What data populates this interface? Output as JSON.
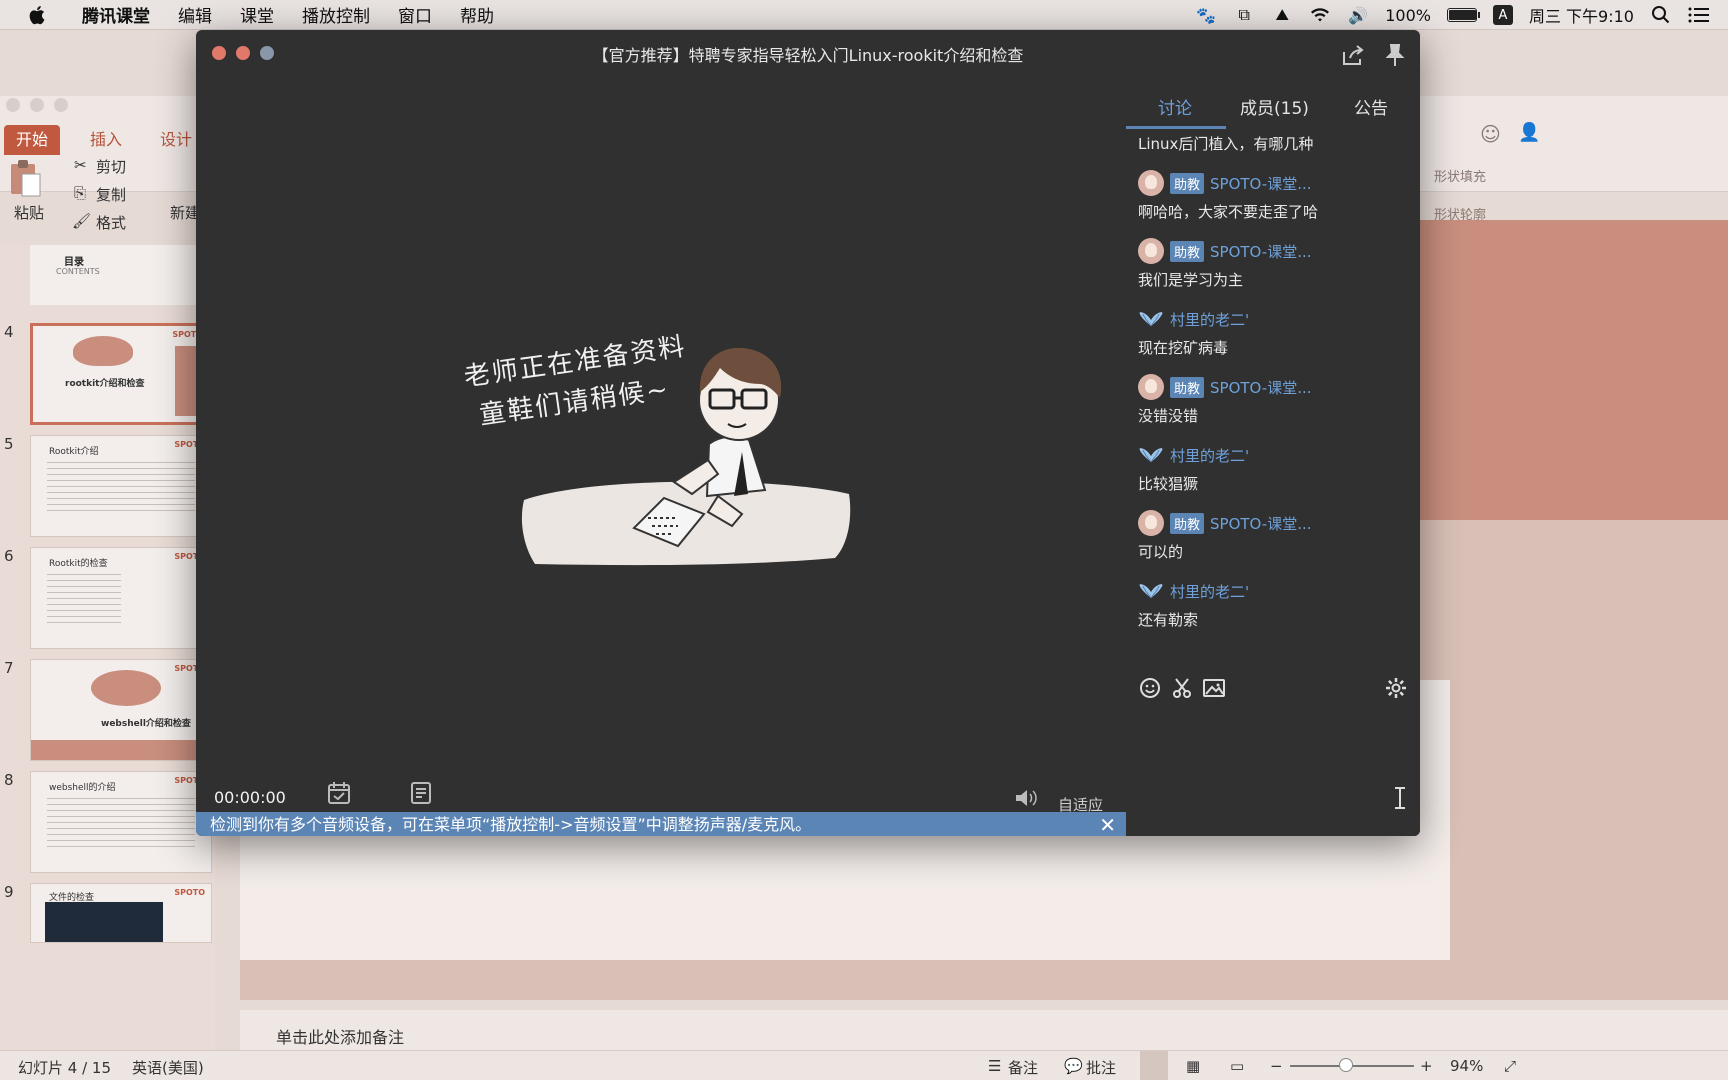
{
  "menubar": {
    "app_name": "腾讯课堂",
    "menus": [
      "编辑",
      "课堂",
      "播放控制",
      "窗口",
      "帮助"
    ],
    "battery": "100%",
    "ime": "A",
    "clock": "周三 下午9:10"
  },
  "ppt": {
    "tabs": [
      "开始",
      "插入",
      "设计"
    ],
    "paste_label": "粘贴",
    "cut_label": "剪切",
    "copy_label": "复制",
    "format_label": "格式",
    "new_slide_label": "新建幻灯片",
    "shape_fill": "形状填充",
    "shape_outline": "形状轮廓",
    "thumb_toc_title": "目录",
    "thumb_toc_sub": "CONTENTS",
    "slide_numbers": [
      "4",
      "5",
      "6",
      "7",
      "8",
      "9"
    ],
    "thumb_titles": [
      "rootkit介绍和检查",
      "Rootkit介绍",
      "Rootkit的检查",
      "webshell介绍和检查",
      "webshell的介绍",
      "文件的检查"
    ],
    "thumb_brand": "SPOTO",
    "notes_placeholder": "单击此处添加备注",
    "status": {
      "slide_pos": "幻灯片 4 / 15",
      "language": "英语(美国)",
      "notes_btn": "备注",
      "comments_btn": "批注",
      "zoom": "94%"
    },
    "zoom_fraction": 0.45
  },
  "window": {
    "title": "【官方推荐】特聘专家指导轻松入门Linux-rookit介绍和检查",
    "video_message_line1": "老师正在准备资料",
    "video_message_line2": "童鞋们请稍候~",
    "time": "00:00:00",
    "fit_label": "自适应",
    "notice": "检测到你有多个音频设备，可在菜单项“播放控制->音频设置”中调整扬声器/麦克风。"
  },
  "panel": {
    "tabs": [
      "讨论",
      "成员(15)",
      "公告"
    ],
    "active_tab": 0,
    "messages": [
      {
        "type": "text",
        "text": "Linux后门植入，有哪几种"
      },
      {
        "type": "sender",
        "avatar": "girl-avatar",
        "badge": "助教",
        "name": "SPOTO-课堂..."
      },
      {
        "type": "text",
        "text": "啊哈哈，大家不要走歪了哈"
      },
      {
        "type": "sender",
        "avatar": "girl-avatar",
        "badge": "助教",
        "name": "SPOTO-课堂..."
      },
      {
        "type": "text",
        "text": "我们是学习为主"
      },
      {
        "type": "sender",
        "avatar": "wing-avatar",
        "badge": "",
        "name": "村里的老二'"
      },
      {
        "type": "text",
        "text": "现在挖矿病毒"
      },
      {
        "type": "sender",
        "avatar": "girl-avatar",
        "badge": "助教",
        "name": "SPOTO-课堂..."
      },
      {
        "type": "text",
        "text": "没错没错"
      },
      {
        "type": "sender",
        "avatar": "wing-avatar",
        "badge": "",
        "name": "村里的老二'"
      },
      {
        "type": "text",
        "text": "比较猖獗"
      },
      {
        "type": "sender",
        "avatar": "girl-avatar",
        "badge": "助教",
        "name": "SPOTO-课堂..."
      },
      {
        "type": "text",
        "text": "可以的"
      },
      {
        "type": "sender",
        "avatar": "wing-avatar",
        "badge": "",
        "name": "村里的老二'"
      },
      {
        "type": "text",
        "text": "还有勒索"
      }
    ]
  },
  "colors": {
    "accent_blue": "#5b85b5",
    "link_blue": "#6ea1da",
    "window_bg": "#303030",
    "ppt_accent": "#c0593f"
  }
}
